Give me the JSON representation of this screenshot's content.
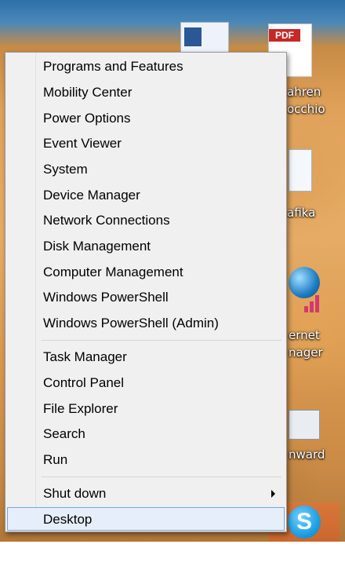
{
  "desktop": {
    "icon_labels": [
      "ahren",
      "occhio",
      "afika",
      "ernet",
      "nager",
      "nward"
    ],
    "pdf_tag": "PDF",
    "skype_glyph": "S"
  },
  "menu": {
    "group1": [
      {
        "label": "Programs and Features"
      },
      {
        "label": "Mobility Center"
      },
      {
        "label": "Power Options"
      },
      {
        "label": "Event Viewer"
      },
      {
        "label": "System"
      },
      {
        "label": "Device Manager"
      },
      {
        "label": "Network Connections"
      },
      {
        "label": "Disk Management"
      },
      {
        "label": "Computer Management"
      },
      {
        "label": "Windows PowerShell"
      },
      {
        "label": "Windows PowerShell (Admin)"
      }
    ],
    "group2": [
      {
        "label": "Task Manager"
      },
      {
        "label": "Control Panel"
      },
      {
        "label": "File Explorer"
      },
      {
        "label": "Search"
      },
      {
        "label": "Run"
      }
    ],
    "group3": [
      {
        "label": "Shut down",
        "has_submenu": true
      },
      {
        "label": "Desktop",
        "highlighted": true
      }
    ],
    "highlight_color": "#e5eef9",
    "highlight_border": "#7aa4d8"
  }
}
